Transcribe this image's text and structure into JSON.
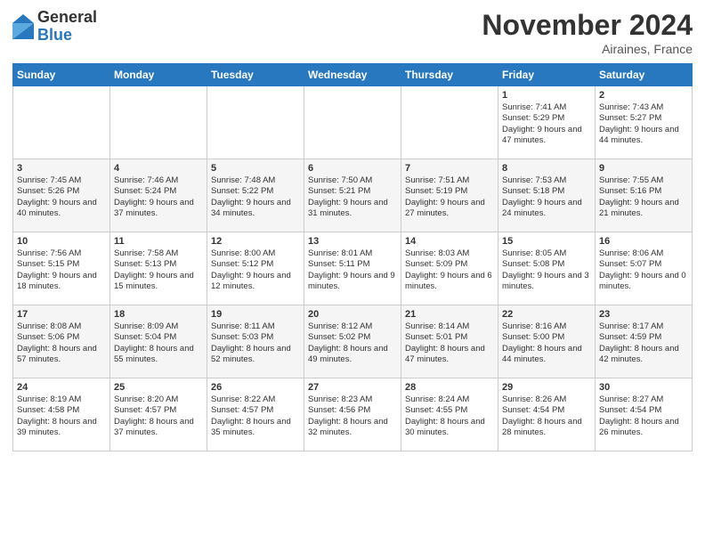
{
  "header": {
    "logo_general": "General",
    "logo_blue": "Blue",
    "month_title": "November 2024",
    "location": "Airaines, France"
  },
  "days_of_week": [
    "Sunday",
    "Monday",
    "Tuesday",
    "Wednesday",
    "Thursday",
    "Friday",
    "Saturday"
  ],
  "weeks": [
    [
      {
        "day": "",
        "info": ""
      },
      {
        "day": "",
        "info": ""
      },
      {
        "day": "",
        "info": ""
      },
      {
        "day": "",
        "info": ""
      },
      {
        "day": "",
        "info": ""
      },
      {
        "day": "1",
        "info": "Sunrise: 7:41 AM\nSunset: 5:29 PM\nDaylight: 9 hours and 47 minutes."
      },
      {
        "day": "2",
        "info": "Sunrise: 7:43 AM\nSunset: 5:27 PM\nDaylight: 9 hours and 44 minutes."
      }
    ],
    [
      {
        "day": "3",
        "info": "Sunrise: 7:45 AM\nSunset: 5:26 PM\nDaylight: 9 hours and 40 minutes."
      },
      {
        "day": "4",
        "info": "Sunrise: 7:46 AM\nSunset: 5:24 PM\nDaylight: 9 hours and 37 minutes."
      },
      {
        "day": "5",
        "info": "Sunrise: 7:48 AM\nSunset: 5:22 PM\nDaylight: 9 hours and 34 minutes."
      },
      {
        "day": "6",
        "info": "Sunrise: 7:50 AM\nSunset: 5:21 PM\nDaylight: 9 hours and 31 minutes."
      },
      {
        "day": "7",
        "info": "Sunrise: 7:51 AM\nSunset: 5:19 PM\nDaylight: 9 hours and 27 minutes."
      },
      {
        "day": "8",
        "info": "Sunrise: 7:53 AM\nSunset: 5:18 PM\nDaylight: 9 hours and 24 minutes."
      },
      {
        "day": "9",
        "info": "Sunrise: 7:55 AM\nSunset: 5:16 PM\nDaylight: 9 hours and 21 minutes."
      }
    ],
    [
      {
        "day": "10",
        "info": "Sunrise: 7:56 AM\nSunset: 5:15 PM\nDaylight: 9 hours and 18 minutes."
      },
      {
        "day": "11",
        "info": "Sunrise: 7:58 AM\nSunset: 5:13 PM\nDaylight: 9 hours and 15 minutes."
      },
      {
        "day": "12",
        "info": "Sunrise: 8:00 AM\nSunset: 5:12 PM\nDaylight: 9 hours and 12 minutes."
      },
      {
        "day": "13",
        "info": "Sunrise: 8:01 AM\nSunset: 5:11 PM\nDaylight: 9 hours and 9 minutes."
      },
      {
        "day": "14",
        "info": "Sunrise: 8:03 AM\nSunset: 5:09 PM\nDaylight: 9 hours and 6 minutes."
      },
      {
        "day": "15",
        "info": "Sunrise: 8:05 AM\nSunset: 5:08 PM\nDaylight: 9 hours and 3 minutes."
      },
      {
        "day": "16",
        "info": "Sunrise: 8:06 AM\nSunset: 5:07 PM\nDaylight: 9 hours and 0 minutes."
      }
    ],
    [
      {
        "day": "17",
        "info": "Sunrise: 8:08 AM\nSunset: 5:06 PM\nDaylight: 8 hours and 57 minutes."
      },
      {
        "day": "18",
        "info": "Sunrise: 8:09 AM\nSunset: 5:04 PM\nDaylight: 8 hours and 55 minutes."
      },
      {
        "day": "19",
        "info": "Sunrise: 8:11 AM\nSunset: 5:03 PM\nDaylight: 8 hours and 52 minutes."
      },
      {
        "day": "20",
        "info": "Sunrise: 8:12 AM\nSunset: 5:02 PM\nDaylight: 8 hours and 49 minutes."
      },
      {
        "day": "21",
        "info": "Sunrise: 8:14 AM\nSunset: 5:01 PM\nDaylight: 8 hours and 47 minutes."
      },
      {
        "day": "22",
        "info": "Sunrise: 8:16 AM\nSunset: 5:00 PM\nDaylight: 8 hours and 44 minutes."
      },
      {
        "day": "23",
        "info": "Sunrise: 8:17 AM\nSunset: 4:59 PM\nDaylight: 8 hours and 42 minutes."
      }
    ],
    [
      {
        "day": "24",
        "info": "Sunrise: 8:19 AM\nSunset: 4:58 PM\nDaylight: 8 hours and 39 minutes."
      },
      {
        "day": "25",
        "info": "Sunrise: 8:20 AM\nSunset: 4:57 PM\nDaylight: 8 hours and 37 minutes."
      },
      {
        "day": "26",
        "info": "Sunrise: 8:22 AM\nSunset: 4:57 PM\nDaylight: 8 hours and 35 minutes."
      },
      {
        "day": "27",
        "info": "Sunrise: 8:23 AM\nSunset: 4:56 PM\nDaylight: 8 hours and 32 minutes."
      },
      {
        "day": "28",
        "info": "Sunrise: 8:24 AM\nSunset: 4:55 PM\nDaylight: 8 hours and 30 minutes."
      },
      {
        "day": "29",
        "info": "Sunrise: 8:26 AM\nSunset: 4:54 PM\nDaylight: 8 hours and 28 minutes."
      },
      {
        "day": "30",
        "info": "Sunrise: 8:27 AM\nSunset: 4:54 PM\nDaylight: 8 hours and 26 minutes."
      }
    ]
  ]
}
